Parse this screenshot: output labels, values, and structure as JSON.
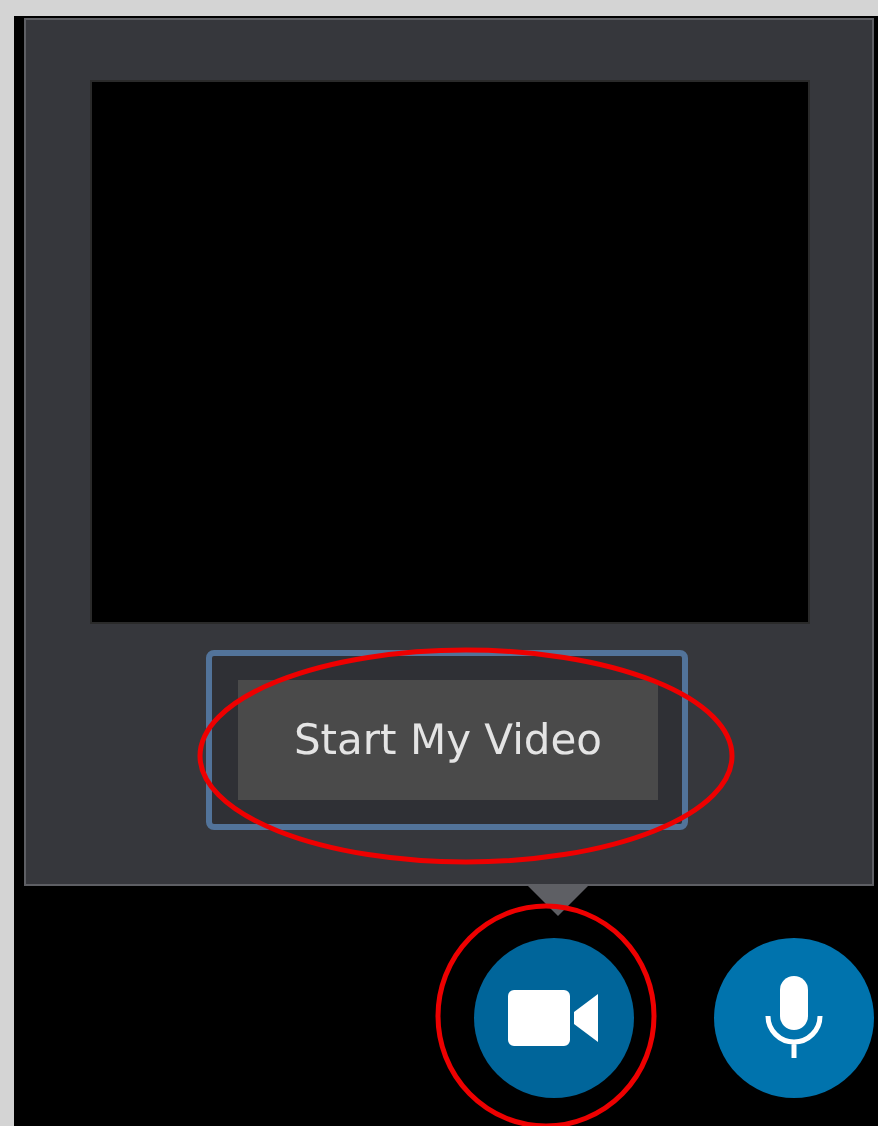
{
  "popup": {
    "button": {
      "label": "Start My Video",
      "focused": true
    }
  },
  "controls": [
    {
      "kind": "video",
      "highlighted": true
    },
    {
      "kind": "microphone",
      "highlighted": false
    }
  ]
}
